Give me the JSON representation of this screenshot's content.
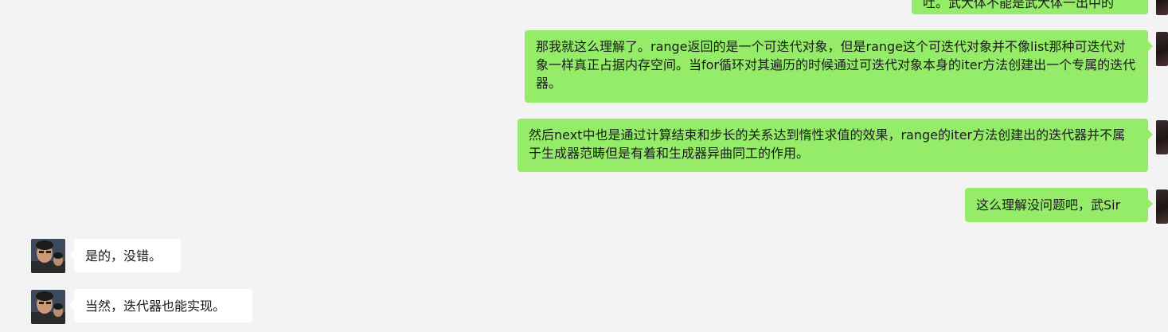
{
  "chat": {
    "messages": [
      {
        "sender": "self",
        "text": "吐。武大体不能是武大体一出中的"
      },
      {
        "sender": "self",
        "text": "那我就这么理解了。range返回的是一个可迭代对象，但是range这个可迭代对象并不像list那种可迭代对象一样真正占据内存空间。当for循环对其遍历的时候通过可迭代对象本身的iter方法创建出一个专属的迭代器。"
      },
      {
        "sender": "self",
        "text": "然后next中也是通过计算结束和步长的关系达到惰性求值的效果，range的iter方法创建出的迭代器并不属于生成器范畴但是有着和生成器异曲同工的作用。"
      },
      {
        "sender": "self",
        "text": "这么理解没问题吧，武Sir"
      },
      {
        "sender": "other",
        "text": "是的，没错。"
      },
      {
        "sender": "other",
        "text": "当然，迭代器也能实现。"
      }
    ]
  },
  "colors": {
    "background": "#f3f3f3",
    "self_bubble": "#95ec69",
    "other_bubble": "#ffffff",
    "text": "#1a1a1a"
  },
  "icons": {
    "self_avatar": "user-avatar-photo",
    "other_avatar": "contact-avatar-photo"
  }
}
